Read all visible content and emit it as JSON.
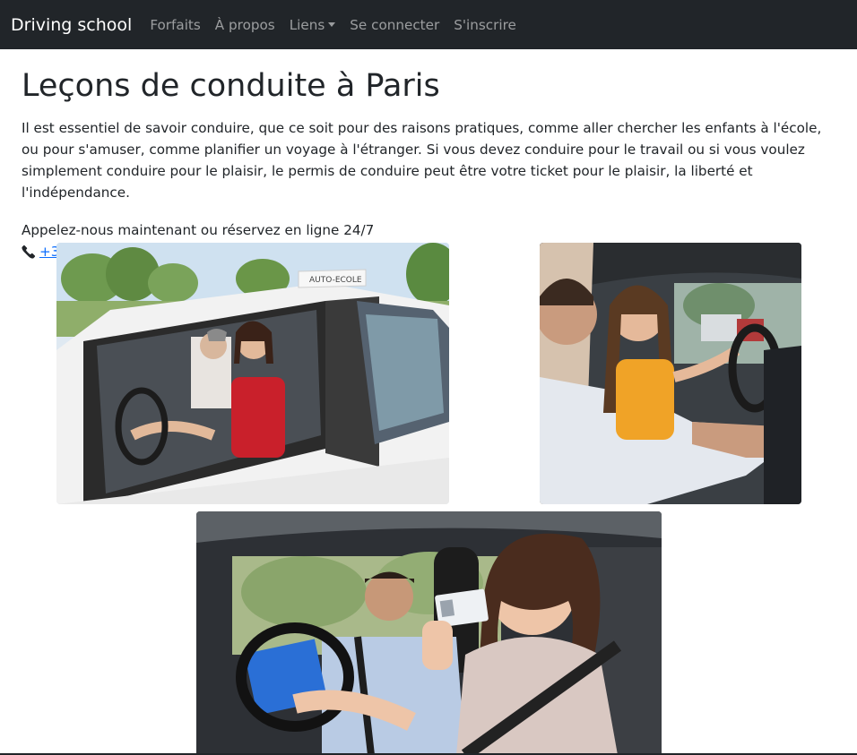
{
  "nav": {
    "brand": "Driving school",
    "items": [
      {
        "label": "Forfaits"
      },
      {
        "label": "À propos"
      },
      {
        "label": "Liens",
        "dropdown": true
      },
      {
        "label": "Se connecter"
      },
      {
        "label": "S'inscrire"
      }
    ]
  },
  "main": {
    "title": "Leçons de conduite à Paris",
    "intro": "Il est essentiel de savoir conduire, que ce soit pour des raisons pratiques, comme aller chercher les enfants à l'école, ou pour s'amuser, comme planifier un voyage à l'étranger. Si vous devez conduire pour le travail ou si vous voulez simplement conduire pour le plaisir, le permis de conduire peut être votre ticket pour le plaisir, la liberté et l'indépendance.",
    "call_text": "Appelez-nous maintenant ou réservez en ligne 24/7",
    "phone": "+33144626215"
  },
  "photos": {
    "photo1_sign": "AUTO-ECOLE"
  },
  "colors": {
    "navbar_bg": "#212529",
    "link": "#0d6efd"
  }
}
